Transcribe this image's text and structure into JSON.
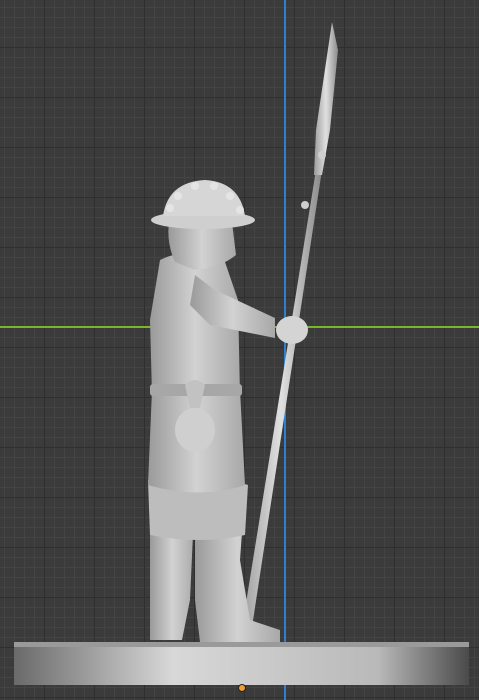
{
  "viewport": {
    "grid_color": "#3b3b3b",
    "axis_z_color": "#2f7fd0",
    "axis_y_color": "#78b62a",
    "origin_color": "#f0a030",
    "model_color": "#c8c8c8"
  },
  "model": {
    "name_icon": "soldier-with-spear-figure",
    "parts": [
      "helmet",
      "head",
      "torso",
      "arm",
      "pouch",
      "legs",
      "boots",
      "spear",
      "base"
    ]
  }
}
